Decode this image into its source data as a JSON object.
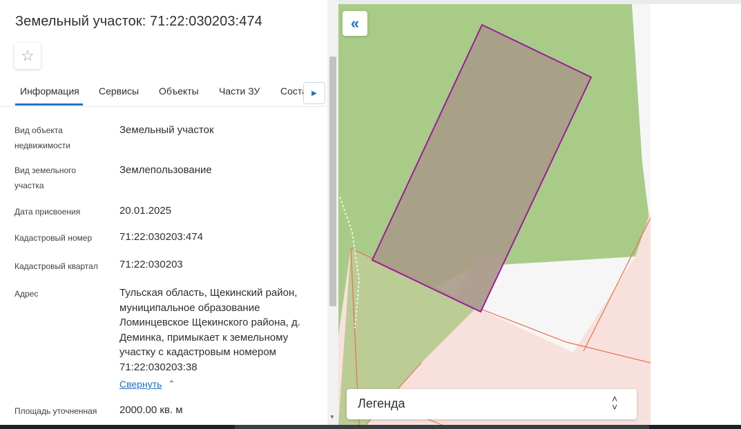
{
  "panel": {
    "title": "Земельный участок: 71:22:030203:474",
    "favorite_icon": "star-icon",
    "tabs": [
      {
        "label": "Информация",
        "active": true
      },
      {
        "label": "Сервисы"
      },
      {
        "label": "Объекты"
      },
      {
        "label": "Части ЗУ"
      },
      {
        "label": "Соста..."
      }
    ],
    "tab_next_icon": "triangle-right-icon",
    "fields": [
      {
        "label": "Вид объекта недвижимости",
        "value": "Земельный участок"
      },
      {
        "label": "Вид земельного участка",
        "value": "Землепользование"
      },
      {
        "label": "Дата присвоения",
        "value": "20.01.2025"
      },
      {
        "label": "Кадастровый номер",
        "value": "71:22:030203:474"
      },
      {
        "label": "Кадастровый квартал",
        "value": "71:22:030203"
      },
      {
        "label": "Адрес",
        "value": "Тульская область, Щекинский район, муниципальное образование Ломинцевское Щекинского района, д. Деминка, примыкает к земельному участку с кадастровым номером 71:22:030203:38"
      },
      {
        "label": "Площадь уточненная",
        "value": "2000.00 кв. м"
      }
    ],
    "collapse_link": "Свернуть"
  },
  "map": {
    "collapse_icon": "double-chevron-left-icon",
    "legend_label": "Легенда",
    "legend_icon": "up-down-chevron-icon",
    "colors": {
      "greenery": "#a8cc88",
      "parcel_fill": "#a89b88",
      "parcel_stroke": "#9b1b9b",
      "pink_zone": "#f8e1dc",
      "orange_line": "#e8704a",
      "highlight": "#e6b8d8"
    }
  }
}
